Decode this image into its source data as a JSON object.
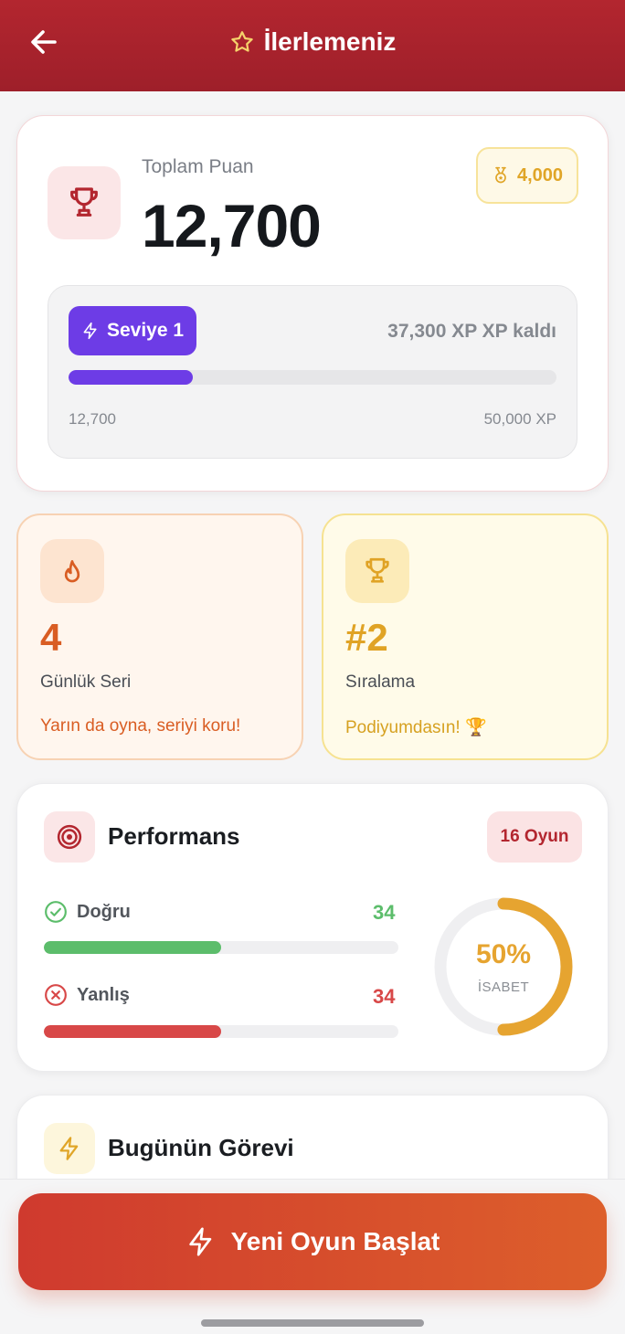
{
  "header": {
    "title": "İlerlemeniz",
    "back_icon": "arrow-left-icon",
    "title_icon": "star-icon"
  },
  "points": {
    "label": "Toplam Puan",
    "value": "12,700",
    "badge_value": "4,000",
    "badge_icon": "medal-icon",
    "level_label": "Seviye 1",
    "xp_remaining": "37,300 XP XP kaldı",
    "progress_fraction": 0.254,
    "progress_min": "12,700",
    "progress_max": "50,000 XP"
  },
  "streak": {
    "value": "4",
    "label": "Günlük Seri",
    "note": "Yarın da oyna, seriyi koru!",
    "icon": "flame-icon"
  },
  "rank": {
    "value": "#2",
    "label": "Sıralama",
    "note": "Podiyumdasın! 🏆",
    "icon": "trophy-icon"
  },
  "performance": {
    "title": "Performans",
    "games": "16 Oyun",
    "correct_label": "Doğru",
    "correct_value": "34",
    "correct_fraction": 0.5,
    "wrong_label": "Yanlış",
    "wrong_value": "34",
    "wrong_fraction": 0.5,
    "accuracy_fraction": 0.5,
    "accuracy_pct": "50%",
    "accuracy_label": "İSABET"
  },
  "task": {
    "title": "Bugünün Görevi",
    "icon": "bolt-icon"
  },
  "cta": {
    "label": "Yeni Oyun Başlat"
  },
  "colors": {
    "brand": "#b3262f",
    "level": "#6d3ce6",
    "correct": "#5cbd6b",
    "wrong": "#d84848",
    "accuracy": "#e6a430"
  }
}
